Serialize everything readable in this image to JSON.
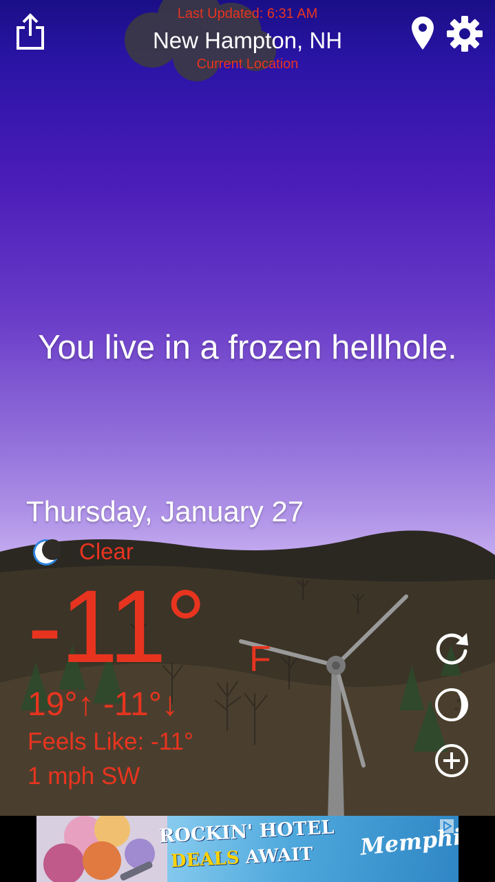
{
  "header": {
    "last_updated": "Last Updated: 6:31 AM",
    "city": "New Hampton, NH",
    "current_location": "Current Location"
  },
  "main": {
    "tagline": "You live in a frozen hellhole.",
    "date": "Thursday, January 27",
    "condition": "Clear",
    "condition_icon": "moon-icon",
    "temperature": "-11°",
    "unit": "F",
    "high": "19°",
    "low": "-11°",
    "feels_like": "Feels Like: -11°",
    "wind": "1 mph SW"
  },
  "side_buttons": [
    "refresh-icon",
    "moon-phase-icon",
    "add-icon"
  ],
  "ad": {
    "line1": "ROCKIN' HOTEL",
    "line2_highlight": "DEALS",
    "line2_rest": "AWAIT",
    "brand": "Memphis"
  },
  "colors": {
    "accent_red": "#e8341f",
    "sky_top": "#1a0f86",
    "sky_bottom": "#c2a8ef",
    "ground": "#3a3226"
  }
}
